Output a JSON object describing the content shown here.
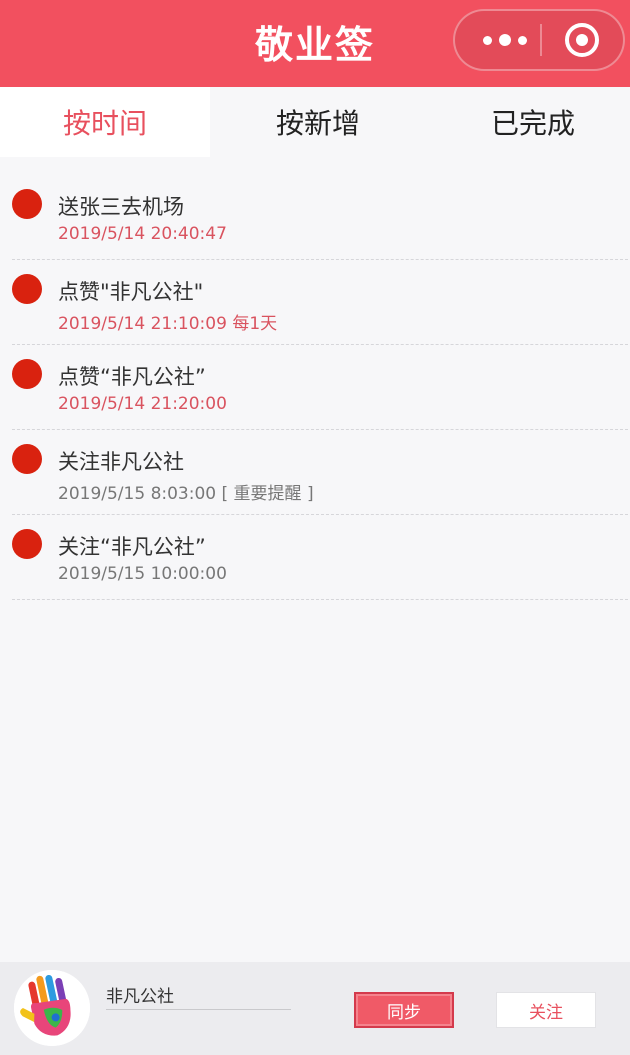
{
  "header": {
    "title": "敬业签",
    "more_icon": "more-dots-icon",
    "close_icon": "close-target-icon"
  },
  "tabs": [
    {
      "label": "按时间",
      "active": true
    },
    {
      "label": "按新增",
      "active": false
    },
    {
      "label": "已完成",
      "active": false
    }
  ],
  "items": [
    {
      "title": "送张三去机场",
      "time": "2019/5/14 20:40:47",
      "extra": "",
      "meta_color": "red"
    },
    {
      "title": "点赞\"非凡公社\"",
      "time": "2019/5/14 21:10:09",
      "extra": "每1天",
      "meta_color": "red"
    },
    {
      "title": "点赞“非凡公社”",
      "time": "2019/5/14 21:20:00",
      "extra": "",
      "meta_color": "red"
    },
    {
      "title": "关注非凡公社",
      "time": "2019/5/15 8:03:00",
      "extra": "[ 重要提醒 ]",
      "meta_color": "gray"
    },
    {
      "title": "关注“非凡公社”",
      "time": "2019/5/15 10:00:00",
      "extra": "",
      "meta_color": "gray"
    }
  ],
  "bottom_bar": {
    "name": "非凡公社",
    "sync_label": "同步",
    "follow_label": "关注",
    "avatar_icon": "colorful-hand-avatar"
  },
  "colors": {
    "header": "#f2505f",
    "accent": "#e8505e",
    "dot": "#d9220f",
    "meta_red": "#d9535f",
    "meta_gray": "#777777"
  }
}
